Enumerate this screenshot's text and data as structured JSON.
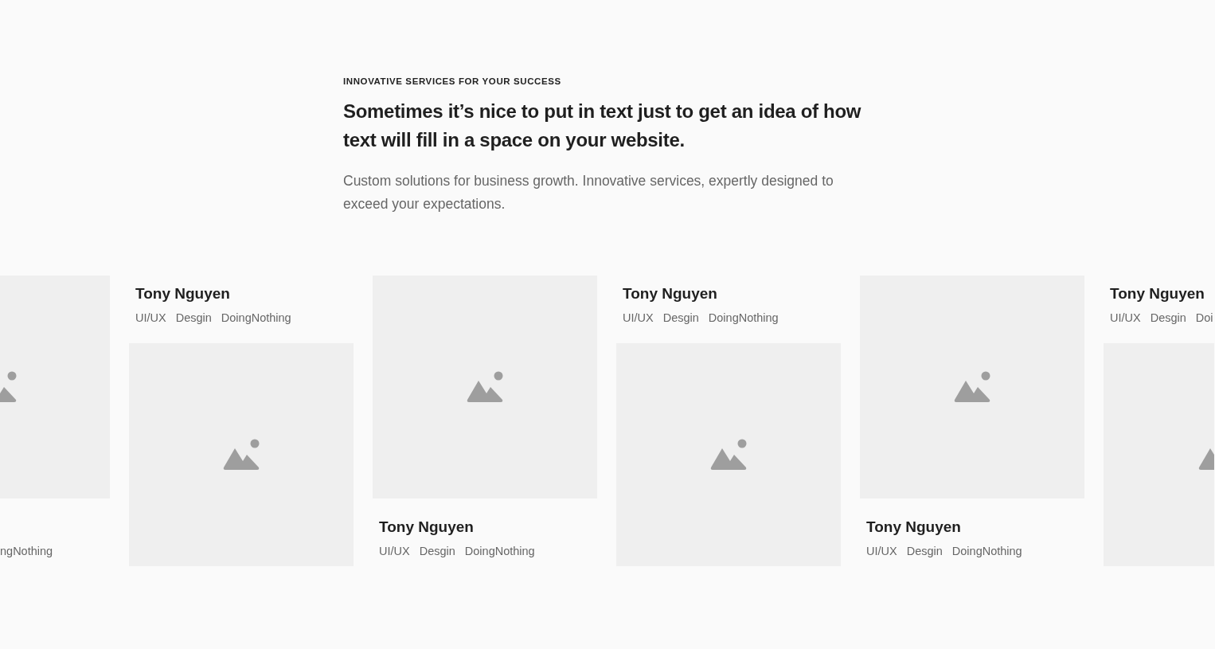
{
  "header": {
    "eyebrow": "INNOVATIVE SERVICES FOR YOUR SUCCESS",
    "title": "Sometimes it’s nice to put in text just to get an idea of how text will fill in a space on your website.",
    "description": "Custom solutions for business growth. Innovative services, expertly designed to exceed your expectations."
  },
  "cards": [
    {
      "kind": "image-top",
      "tags": [
        "ngNothing"
      ]
    },
    {
      "kind": "text-top",
      "name": "Tony Nguyen",
      "tags": [
        "UI/UX",
        "Desgin",
        "DoingNothing"
      ]
    },
    {
      "kind": "image-top",
      "name": "Tony Nguyen",
      "tags": [
        "UI/UX",
        "Desgin",
        "DoingNothing"
      ]
    },
    {
      "kind": "text-top",
      "name": "Tony Nguyen",
      "tags": [
        "UI/UX",
        "Desgin",
        "DoingNothing"
      ]
    },
    {
      "kind": "image-top",
      "name": "Tony Nguyen",
      "tags": [
        "UI/UX",
        "Desgin",
        "DoingNothing"
      ]
    },
    {
      "kind": "text-top",
      "name": "Tony Nguyen",
      "tags": [
        "UI/UX",
        "Desgin",
        "Doi"
      ]
    }
  ]
}
